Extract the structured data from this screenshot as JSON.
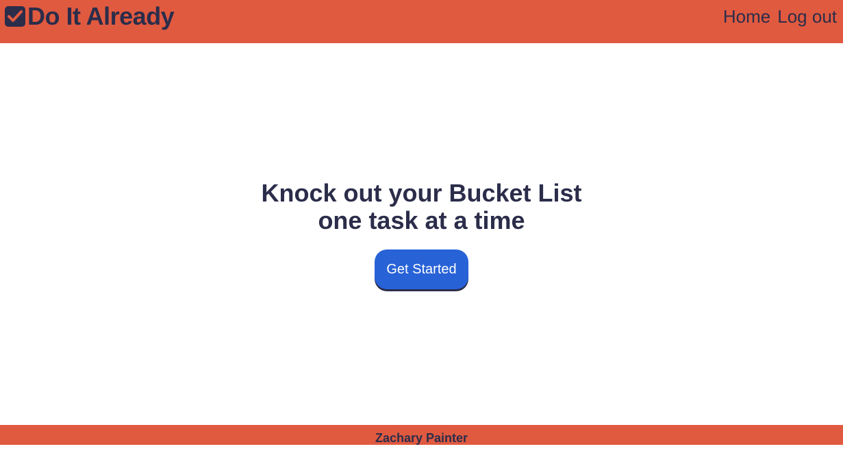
{
  "header": {
    "brand_icon": "checkbox-checked-icon",
    "brand_title": "Do It Already",
    "nav": {
      "home_label": "Home",
      "logout_label": "Log out"
    }
  },
  "hero": {
    "title_line1": "Knock out your Bucket List",
    "title_line2": "one task at a time",
    "cta_label": "Get Started"
  },
  "footer": {
    "author": "Zachary Painter"
  },
  "colors": {
    "header_bg": "#e05a40",
    "text": "#2b2d4a",
    "button": "#2862d7",
    "background": "#ffffff"
  }
}
